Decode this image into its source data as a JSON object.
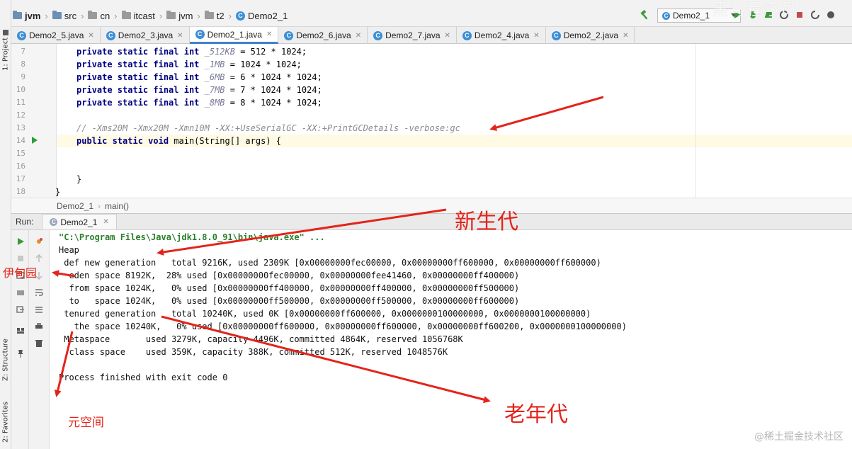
{
  "breadcrumb": {
    "items": [
      "jvm",
      "src",
      "cn",
      "itcast",
      "jvm",
      "t2",
      "Demo2_1"
    ]
  },
  "toolbar": {
    "run_config": "Demo2_1",
    "top_watermark": "黑马程序员"
  },
  "left_stripe": {
    "project": "1: Project",
    "structure": "Z: Structure",
    "favorites": "2: Favorites"
  },
  "tabs": [
    {
      "label": "Demo2_5.java",
      "active": false
    },
    {
      "label": "Demo2_3.java",
      "active": false
    },
    {
      "label": "Demo2_1.java",
      "active": true
    },
    {
      "label": "Demo2_6.java",
      "active": false
    },
    {
      "label": "Demo2_7.java",
      "active": false
    },
    {
      "label": "Demo2_4.java",
      "active": false
    },
    {
      "label": "Demo2_2.java",
      "active": false
    }
  ],
  "editor": {
    "line_numbers": [
      "7",
      "8",
      "9",
      "10",
      "11",
      "12",
      "13",
      "14",
      "15",
      "16",
      "17",
      "18"
    ],
    "lines": [
      {
        "k": "private static final int ",
        "n": "_512KB",
        "r": " = 512 * 1024;"
      },
      {
        "k": "private static final int ",
        "n": "_1MB",
        "r": " = 1024 * 1024;"
      },
      {
        "k": "private static final int ",
        "n": "_6MB",
        "r": " = 6 * 1024 * 1024;"
      },
      {
        "k": "private static final int ",
        "n": "_7MB",
        "r": " = 7 * 1024 * 1024;"
      },
      {
        "k": "private static final int ",
        "n": "_8MB",
        "r": " = 8 * 1024 * 1024;"
      }
    ],
    "comment": "// -Xms20M -Xmx20M -Xmn10M -XX:+UseSerialGC -XX:+PrintGCDetails -verbose:gc",
    "main_kw": "public static void ",
    "main_rest": "main(String[] args) {",
    "close_brace_inner": "}",
    "close_brace_outer": "}",
    "crumb_class": "Demo2_1",
    "crumb_method": "main()"
  },
  "run_panel": {
    "label": "Run:",
    "tab": "Demo2_1",
    "console": [
      "\"C:\\Program Files\\Java\\jdk1.8.0_91\\bin\\java.exe\" ...",
      "Heap",
      " def new generation   total 9216K, used 2309K [0x00000000fec00000, 0x00000000ff600000, 0x00000000ff600000)",
      "  eden space 8192K,  28% used [0x00000000fec00000, 0x00000000fee41460, 0x00000000ff400000)",
      "  from space 1024K,   0% used [0x00000000ff400000, 0x00000000ff400000, 0x00000000ff500000)",
      "  to   space 1024K,   0% used [0x00000000ff500000, 0x00000000ff500000, 0x00000000ff600000)",
      " tenured generation   total 10240K, used 0K [0x00000000ff600000, 0x0000000100000000, 0x0000000100000000)",
      "   the space 10240K,   0% used [0x00000000ff600000, 0x00000000ff600000, 0x00000000ff600200, 0x0000000100000000)",
      " Metaspace       used 3279K, capacity 4496K, committed 4864K, reserved 1056768K",
      "  class space    used 359K, capacity 388K, committed 512K, reserved 1048576K",
      "",
      "Process finished with exit code 0"
    ]
  },
  "annotations": {
    "young_gen": "新生代",
    "old_gen": "老年代",
    "eden": "伊甸园",
    "metaspace": "元空间"
  },
  "watermark": "@稀土掘金技术社区",
  "colors": {
    "annotation": "#e3241b",
    "keyword": "#000080",
    "tab_active_underline": "#4083c9",
    "console_path": "#2a7f2a"
  }
}
